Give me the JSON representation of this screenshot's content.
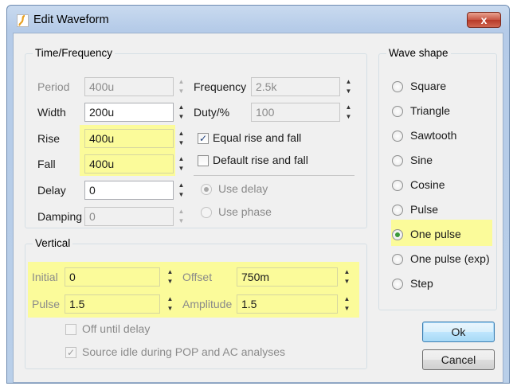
{
  "window": {
    "title": "Edit Waveform",
    "close_glyph": "x"
  },
  "time_frequency": {
    "title": "Time/Frequency",
    "period": {
      "label": "Period",
      "value": "400u"
    },
    "width": {
      "label": "Width",
      "value": "200u"
    },
    "rise": {
      "label": "Rise",
      "value": "400u"
    },
    "fall": {
      "label": "Fall",
      "value": "400u"
    },
    "delay": {
      "label": "Delay",
      "value": "0"
    },
    "damping": {
      "label": "Damping",
      "value": "0"
    },
    "frequency": {
      "label": "Frequency",
      "value": "2.5k"
    },
    "duty": {
      "label": "Duty/%",
      "value": "100"
    },
    "equal_rise_fall": {
      "label": "Equal rise and fall",
      "checked": true
    },
    "default_rise_fall": {
      "label": "Default rise and fall",
      "checked": false
    },
    "use_delay": {
      "label": "Use delay",
      "selected": true
    },
    "use_phase": {
      "label": "Use phase",
      "selected": false
    }
  },
  "vertical": {
    "title": "Vertical",
    "initial": {
      "label": "Initial",
      "value": "0"
    },
    "pulse": {
      "label": "Pulse",
      "value": "1.5"
    },
    "offset": {
      "label": "Offset",
      "value": "750m"
    },
    "amplitude": {
      "label": "Amplitude",
      "value": "1.5"
    },
    "off_until_delay": {
      "label": "Off until delay",
      "checked": false
    },
    "source_idle": {
      "label": "Source idle during POP and AC analyses",
      "checked": true
    }
  },
  "wave_shape": {
    "title": "Wave shape",
    "options": [
      {
        "label": "Square",
        "selected": false
      },
      {
        "label": "Triangle",
        "selected": false
      },
      {
        "label": "Sawtooth",
        "selected": false
      },
      {
        "label": "Sine",
        "selected": false
      },
      {
        "label": "Cosine",
        "selected": false
      },
      {
        "label": "Pulse",
        "selected": false
      },
      {
        "label": "One pulse",
        "selected": true
      },
      {
        "label": "One pulse (exp)",
        "selected": false
      },
      {
        "label": "Step",
        "selected": false
      }
    ]
  },
  "buttons": {
    "ok": "Ok",
    "cancel": "Cancel"
  },
  "glyphs": {
    "spin_up": "▲",
    "spin_down": "▼",
    "check": "✓"
  },
  "colors": {
    "highlight": "#fbfb9a",
    "title_bar": "#c9daef",
    "close": "#c75544",
    "selected_radio": "#3a9a3a"
  }
}
